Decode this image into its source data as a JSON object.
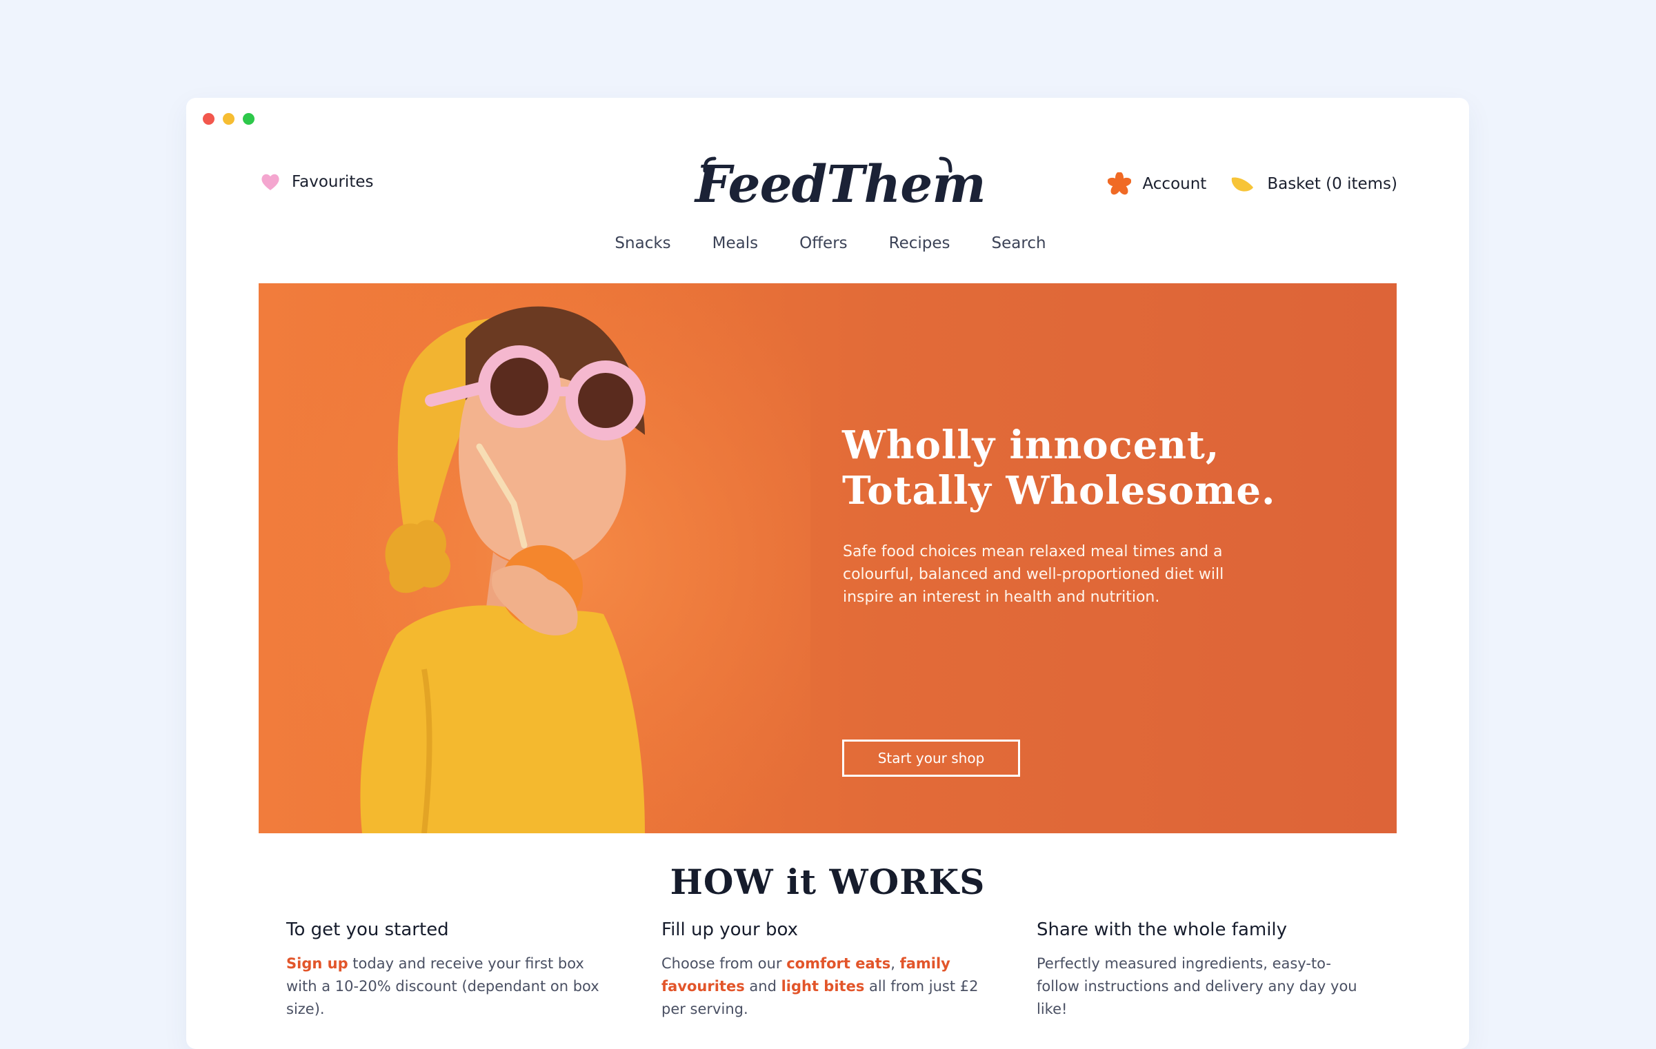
{
  "header": {
    "favourites_label": "Favourites",
    "account_label": "Account",
    "basket_label": "Basket (0 items)",
    "logo_text": "FeedThem"
  },
  "nav": [
    "Snacks",
    "Meals",
    "Offers",
    "Recipes",
    "Search"
  ],
  "hero": {
    "title_line1": "Wholly innocent,",
    "title_line2": "Totally Wholesome.",
    "copy": "Safe food choices mean relaxed meal times and a colourful, balanced and well-proportioned diet will inspire an interest in health and nutrition.",
    "button_label": "Start your shop"
  },
  "how": {
    "title": "HOW it WORKS",
    "steps": [
      {
        "title": "To get you started",
        "link": "Sign up",
        "text_a": " today and receive your first box with a 10-20% discount (dependant on box size)."
      },
      {
        "title": "Fill up your box",
        "text_a": "Choose from our ",
        "link1": "comfort eats",
        "sep": ", ",
        "link2": "family favourites",
        "text_b": " and ",
        "link3": "light bites",
        "text_c": " all from just £2 per serving."
      },
      {
        "title": "Share with the whole family",
        "text_a": "Perfectly measured ingredients, easy-to-follow instructions and delivery any day you like!"
      }
    ]
  },
  "colors": {
    "hero_orange": "#e26b38",
    "link_orange": "#e2552a",
    "heart_pink": "#f4a6cf",
    "account_orange": "#f06a25",
    "basket_yellow": "#f7c437"
  },
  "icons": {
    "favourites": "heart-icon",
    "account": "flower-icon",
    "basket": "lemon-icon"
  }
}
